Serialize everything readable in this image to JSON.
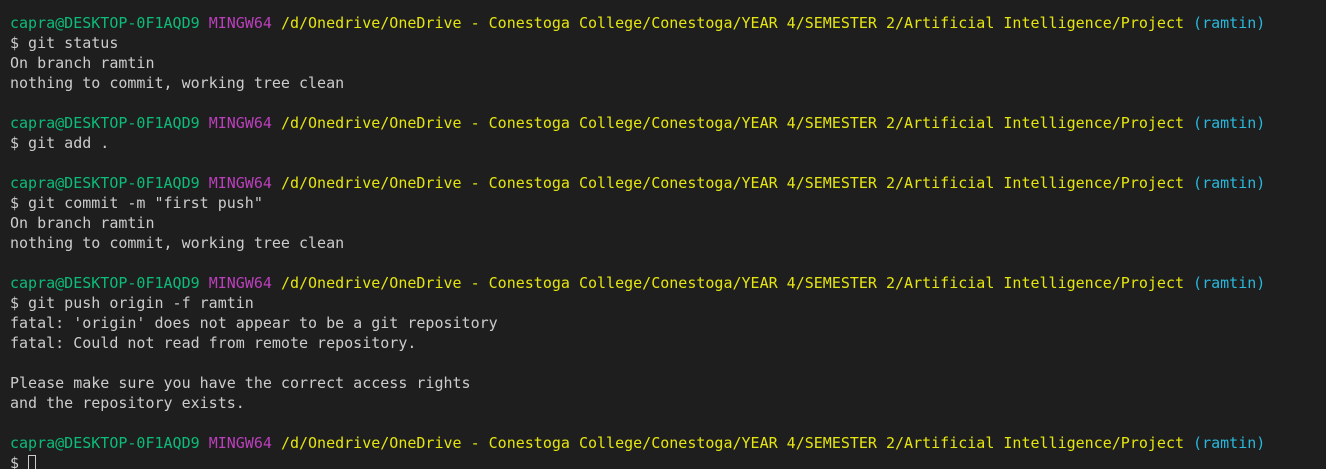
{
  "colors": {
    "background": "#1e1e1e",
    "text": "#cccccc",
    "user_host": "#0dbc79",
    "shell": "#bc3fbc",
    "path": "#e5e510",
    "branch": "#29b8db"
  },
  "prompt": {
    "user_host": "capra@DESKTOP-0F1AQD9",
    "shell": "MINGW64",
    "path": "/d/Onedrive/OneDrive - Conestoga College/Conestoga/YEAR 4/SEMESTER 2/Artificial Intelligence/Project",
    "branch": "(ramtin)"
  },
  "blocks": [
    {
      "command": "$ git status",
      "output": [
        "On branch ramtin",
        "nothing to commit, working tree clean"
      ]
    },
    {
      "command": "$ git add .",
      "output": []
    },
    {
      "command": "$ git commit -m \"first push\"",
      "output": [
        "On branch ramtin",
        "nothing to commit, working tree clean"
      ]
    },
    {
      "command": "$ git push origin -f ramtin",
      "output": [
        "fatal: 'origin' does not appear to be a git repository",
        "fatal: Could not read from remote repository.",
        "",
        "Please make sure you have the correct access rights",
        "and the repository exists."
      ]
    }
  ],
  "current_input": {
    "prompt_symbol": "$",
    "value": ""
  }
}
